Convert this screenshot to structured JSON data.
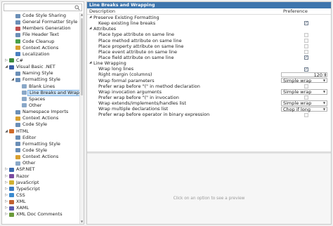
{
  "tree": {
    "nodes": [
      {
        "label": "Code Style Sharing",
        "depth": 1,
        "expander": "",
        "icon": "#6b8fb7"
      },
      {
        "label": "General Formatter Style",
        "depth": 1,
        "expander": "",
        "icon": "#6b8fb7"
      },
      {
        "label": "Members Generation",
        "depth": 1,
        "expander": "",
        "icon": "#c05050"
      },
      {
        "label": "File Header Text",
        "depth": 1,
        "expander": "",
        "icon": "#6b8fb7"
      },
      {
        "label": "Code Cleanup",
        "depth": 1,
        "expander": "",
        "icon": "#4aa04a"
      },
      {
        "label": "Context Actions",
        "depth": 1,
        "expander": "",
        "icon": "#d8a030"
      },
      {
        "label": "Localization",
        "depth": 1,
        "expander": "",
        "icon": "#4a7fc0"
      },
      {
        "label": "C#",
        "depth": 0,
        "expander": "▷",
        "icon": "#3b8a3b"
      },
      {
        "label": "Visual Basic .NET",
        "depth": 0,
        "expander": "◢",
        "icon": "#3a5fa8"
      },
      {
        "label": "Naming Style",
        "depth": 1,
        "expander": "",
        "icon": "#6b8fb7"
      },
      {
        "label": "Formatting Style",
        "depth": 1,
        "expander": "◢",
        "icon": "#6b8fb7"
      },
      {
        "label": "Blank Lines",
        "depth": 2,
        "expander": "",
        "icon": "#8aa8c8"
      },
      {
        "label": "Line Breaks and Wrapping",
        "depth": 2,
        "expander": "",
        "icon": "#8aa8c8",
        "selected": true
      },
      {
        "label": "Spaces",
        "depth": 2,
        "expander": "",
        "icon": "#8aa8c8"
      },
      {
        "label": "Other",
        "depth": 2,
        "expander": "",
        "icon": "#8aa8c8"
      },
      {
        "label": "Namespace Imports",
        "depth": 1,
        "expander": "",
        "icon": "#6b8fb7"
      },
      {
        "label": "Context Actions",
        "depth": 1,
        "expander": "",
        "icon": "#d8a030"
      },
      {
        "label": "Code Style",
        "depth": 1,
        "expander": "",
        "icon": "#6b8fb7"
      },
      {
        "label": "HTML",
        "depth": 0,
        "expander": "◢",
        "icon": "#d06a2a"
      },
      {
        "label": "Editor",
        "depth": 1,
        "expander": "",
        "icon": "#6b8fb7"
      },
      {
        "label": "Formatting Style",
        "depth": 1,
        "expander": "",
        "icon": "#6b8fb7"
      },
      {
        "label": "Code Style",
        "depth": 1,
        "expander": "",
        "icon": "#6b8fb7"
      },
      {
        "label": "Context Actions",
        "depth": 1,
        "expander": "",
        "icon": "#d8a030"
      },
      {
        "label": "Other",
        "depth": 1,
        "expander": "",
        "icon": "#8aa8c8"
      },
      {
        "label": "ASP.NET",
        "depth": 0,
        "expander": "▷",
        "icon": "#3a6ab0"
      },
      {
        "label": "Razor",
        "depth": 0,
        "expander": "▷",
        "icon": "#7a4aa0"
      },
      {
        "label": "JavaScript",
        "depth": 0,
        "expander": "▷",
        "icon": "#d0b030"
      },
      {
        "label": "TypeScript",
        "depth": 0,
        "expander": "▷",
        "icon": "#3a7ac0"
      },
      {
        "label": "CSS",
        "depth": 0,
        "expander": "▷",
        "icon": "#3a8ad0"
      },
      {
        "label": "XML",
        "depth": 0,
        "expander": "▷",
        "icon": "#c06030"
      },
      {
        "label": "XAML",
        "depth": 0,
        "expander": "▷",
        "icon": "#5a5ab0"
      },
      {
        "label": "XML Doc Comments",
        "depth": 0,
        "expander": "▷",
        "icon": "#6a9a3a"
      }
    ]
  },
  "panel": {
    "title": "Line Breaks and Wrapping",
    "col_description": "Description",
    "col_preference": "Preference",
    "preview_text": "Click on an option to see a preview"
  },
  "rows": [
    {
      "type": "group",
      "label": "Preserve Existing Formatting"
    },
    {
      "type": "check",
      "label": "Keep existing line breaks",
      "checked": true
    },
    {
      "type": "group",
      "label": "Attributes"
    },
    {
      "type": "check",
      "label": "Place type attribute on same line",
      "checked": false
    },
    {
      "type": "check",
      "label": "Place method attribute on same line",
      "checked": false
    },
    {
      "type": "check",
      "label": "Place property attribute on same line",
      "checked": false
    },
    {
      "type": "check",
      "label": "Place event attribute on same line",
      "checked": false
    },
    {
      "type": "check",
      "label": "Place field attribute on same line",
      "checked": true
    },
    {
      "type": "group",
      "label": "Line Wrapping"
    },
    {
      "type": "check",
      "label": "Wrap long lines",
      "checked": true
    },
    {
      "type": "number",
      "label": "Right margin (columns)",
      "value": "120"
    },
    {
      "type": "select",
      "label": "Wrap formal parameters",
      "value": "Simple wrap"
    },
    {
      "type": "check",
      "label": "Prefer wrap before \"(\" in method declaration",
      "checked": false
    },
    {
      "type": "select",
      "label": "Wrap invocation arguments",
      "value": "Simple wrap"
    },
    {
      "type": "check",
      "label": "Prefer wrap before \"(\" in invocation",
      "checked": false
    },
    {
      "type": "select",
      "label": "Wrap extends/implements/handles list",
      "value": "Simple wrap"
    },
    {
      "type": "select",
      "label": "Wrap multiple declarations list",
      "value": "Chop if long"
    },
    {
      "type": "check",
      "label": "Prefer wrap before operator in binary expression",
      "checked": false
    }
  ],
  "icons": {
    "search": "search-icon",
    "dropdown": "chevron-down-icon",
    "spinner": "spinner-icon",
    "expand": "triangle-icon",
    "check": "checkmark-icon"
  },
  "colors": {
    "title_bar": "#3d75ad",
    "selection": "#cbe3f7",
    "highlight_row": "#dde9f5"
  }
}
